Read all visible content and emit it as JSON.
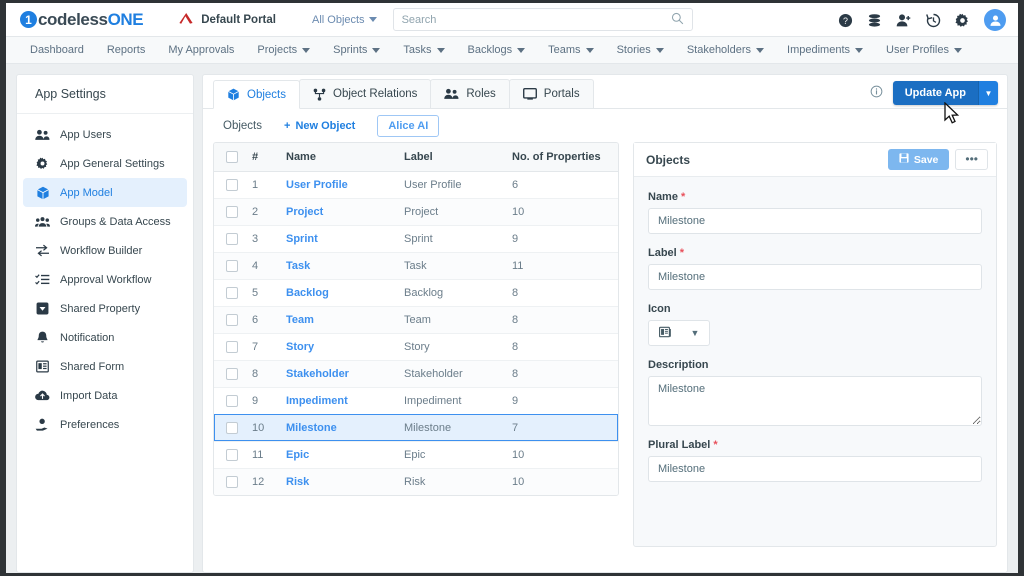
{
  "brand": {
    "logo_part1": "codeless",
    "logo_part2": "ONE",
    "logo_mark": "1"
  },
  "topbar": {
    "portal_name": "Default Portal",
    "portal_icon": "triangle-logo-icon",
    "scope_selector": "All Objects",
    "search": {
      "value": "",
      "placeholder": "Search"
    },
    "icons": [
      "help-circle-icon",
      "database-icon",
      "add-user-icon",
      "history-icon",
      "gear-icon",
      "avatar"
    ]
  },
  "nav": {
    "items": [
      {
        "label": "Dashboard",
        "dropdown": false
      },
      {
        "label": "Reports",
        "dropdown": false
      },
      {
        "label": "My Approvals",
        "dropdown": false
      },
      {
        "label": "Projects",
        "dropdown": true
      },
      {
        "label": "Sprints",
        "dropdown": true
      },
      {
        "label": "Tasks",
        "dropdown": true
      },
      {
        "label": "Backlogs",
        "dropdown": true
      },
      {
        "label": "Teams",
        "dropdown": true
      },
      {
        "label": "Stories",
        "dropdown": true
      },
      {
        "label": "Stakeholders",
        "dropdown": true
      },
      {
        "label": "Impediments",
        "dropdown": true
      },
      {
        "label": "User Profiles",
        "dropdown": true
      }
    ]
  },
  "sidebar": {
    "title": "App Settings",
    "items": [
      {
        "label": "App Users",
        "icon": "users-icon",
        "active": false
      },
      {
        "label": "App General Settings",
        "icon": "gear-icon",
        "active": false
      },
      {
        "label": "App Model",
        "icon": "cube-icon",
        "active": true
      },
      {
        "label": "Groups & Data Access",
        "icon": "group-icon",
        "active": false
      },
      {
        "label": "Workflow Builder",
        "icon": "exchange-arrows-icon",
        "active": false
      },
      {
        "label": "Approval Workflow",
        "icon": "checklist-icon",
        "active": false
      },
      {
        "label": "Shared Property",
        "icon": "tag-icon",
        "active": false
      },
      {
        "label": "Notification",
        "icon": "bell-icon",
        "active": false
      },
      {
        "label": "Shared Form",
        "icon": "form-icon",
        "active": false
      },
      {
        "label": "Import Data",
        "icon": "cloud-upload-icon",
        "active": false
      },
      {
        "label": "Preferences",
        "icon": "hand-gear-icon",
        "active": false
      }
    ]
  },
  "main": {
    "tabs": [
      {
        "label": "Objects",
        "icon": "cube-icon",
        "active": true
      },
      {
        "label": "Object Relations",
        "icon": "hierarchy-icon",
        "active": false
      },
      {
        "label": "Roles",
        "icon": "people-icon",
        "active": false
      },
      {
        "label": "Portals",
        "icon": "monitor-icon",
        "active": false
      }
    ],
    "info_icon": "info-icon",
    "update_button": {
      "label": "Update App",
      "caret": "chevron-down-icon"
    },
    "toolbar": {
      "section_label": "Objects",
      "new_object_label": "New Object",
      "new_object_icon": "plus-icon",
      "alice_label": "Alice AI"
    },
    "table": {
      "columns": [
        "#",
        "Name",
        "Label",
        "No. of Properties"
      ],
      "rows": [
        {
          "num": "1",
          "name": "User Profile",
          "label": "User Profile",
          "props": "6",
          "selected": false
        },
        {
          "num": "2",
          "name": "Project",
          "label": "Project",
          "props": "10",
          "selected": false
        },
        {
          "num": "3",
          "name": "Sprint",
          "label": "Sprint",
          "props": "9",
          "selected": false
        },
        {
          "num": "4",
          "name": "Task",
          "label": "Task",
          "props": "11",
          "selected": false
        },
        {
          "num": "5",
          "name": "Backlog",
          "label": "Backlog",
          "props": "8",
          "selected": false
        },
        {
          "num": "6",
          "name": "Team",
          "label": "Team",
          "props": "8",
          "selected": false
        },
        {
          "num": "7",
          "name": "Story",
          "label": "Story",
          "props": "8",
          "selected": false
        },
        {
          "num": "8",
          "name": "Stakeholder",
          "label": "Stakeholder",
          "props": "8",
          "selected": false
        },
        {
          "num": "9",
          "name": "Impediment",
          "label": "Impediment",
          "props": "9",
          "selected": false
        },
        {
          "num": "10",
          "name": "Milestone",
          "label": "Milestone",
          "props": "7",
          "selected": true
        },
        {
          "num": "11",
          "name": "Epic",
          "label": "Epic",
          "props": "10",
          "selected": false
        },
        {
          "num": "12",
          "name": "Risk",
          "label": "Risk",
          "props": "10",
          "selected": false
        }
      ]
    }
  },
  "panel": {
    "title": "Objects",
    "save_label": "Save",
    "save_icon": "floppy-disk-icon",
    "more_label": "•••",
    "fields": {
      "name": {
        "label": "Name",
        "required": true,
        "value": "Milestone"
      },
      "label": {
        "label": "Label",
        "required": true,
        "value": "Milestone"
      },
      "icon": {
        "label": "Icon",
        "required": false,
        "glyph": "newspaper-icon",
        "caret": "chevron-down-icon"
      },
      "description": {
        "label": "Description",
        "required": false,
        "value": "Milestone"
      },
      "plural_label": {
        "label": "Plural Label",
        "required": true,
        "value": "Milestone"
      }
    }
  },
  "colors": {
    "accent": "#1f7fe0",
    "link": "#3d90ef",
    "selected_row_bg": "#e4f0fd",
    "required_red": "#e8505b",
    "save_blue": "#7db7ef"
  }
}
